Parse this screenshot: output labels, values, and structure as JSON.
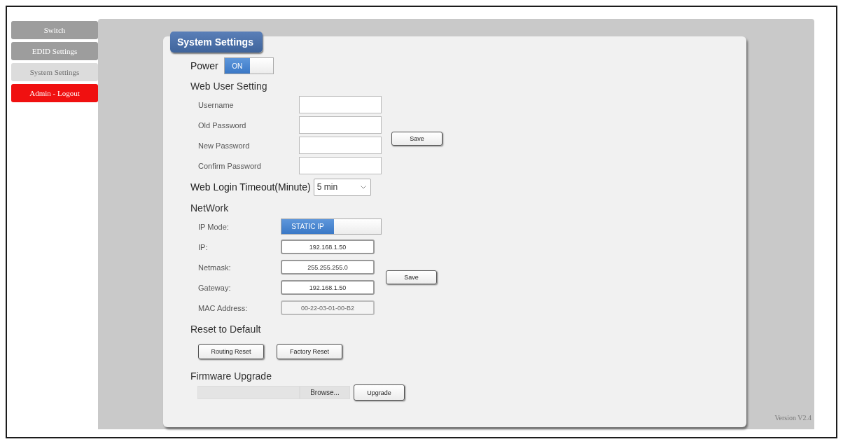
{
  "sidebar": {
    "items": [
      {
        "label": "Switch",
        "kind": "nav",
        "selected": false
      },
      {
        "label": "EDID Settings",
        "kind": "nav",
        "selected": false
      },
      {
        "label": "System Settings",
        "kind": "nav",
        "selected": true
      },
      {
        "label": "Admin - Logout",
        "kind": "logout",
        "selected": false
      }
    ]
  },
  "panel": {
    "title": "System Settings",
    "power": {
      "label": "Power",
      "toggle": {
        "label": "ON",
        "on": true
      }
    },
    "web_user": {
      "heading": "Web User Setting",
      "fields": [
        {
          "label": "Username"
        },
        {
          "label": "Old Password"
        },
        {
          "label": "New Password"
        },
        {
          "label": "Confirm Password"
        }
      ],
      "save_button": "Save"
    },
    "timeout": {
      "label": "Web Login Timeout(Minute)",
      "value": "5 min"
    },
    "network": {
      "heading": "NetWork",
      "ip_mode": {
        "label": "IP Mode:",
        "toggle": {
          "label": "STATIC IP",
          "on": true
        }
      },
      "fields": [
        {
          "label": "IP:",
          "value": "192.168.1.50",
          "disabled": false
        },
        {
          "label": "Netmask:",
          "value": "255.255.255.0",
          "disabled": false
        },
        {
          "label": "Gateway:",
          "value": "192.168.1.50",
          "disabled": false
        },
        {
          "label": "MAC Address:",
          "value": "00-22-03-01-00-B2",
          "disabled": true
        }
      ],
      "save_button": "Save"
    },
    "reset": {
      "heading": "Reset to Default",
      "buttons": [
        "Routing Reset",
        "Factory Reset"
      ]
    },
    "firmware": {
      "heading": "Firmware Upgrade",
      "browse_button": "Browse...",
      "upgrade_button": "Upgrade"
    }
  },
  "version": "Version V2.4"
}
